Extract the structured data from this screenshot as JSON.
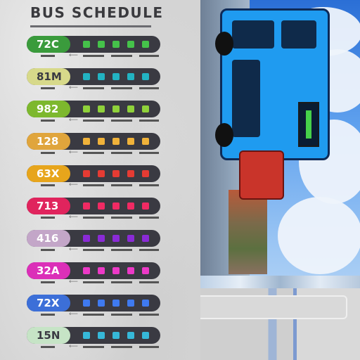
{
  "header": {
    "title": "BUS SCHEDULE"
  },
  "routes": [
    {
      "label": "72C",
      "color": "#3a9b3c",
      "dot_color": "#45c24a",
      "pale": false
    },
    {
      "label": "81M",
      "color": "#d7d98a",
      "dot_color": "#22b3c2",
      "pale": true
    },
    {
      "label": "982",
      "color": "#7db82e",
      "dot_color": "#8fd13a",
      "pale": false
    },
    {
      "label": "128",
      "color": "#e0a53c",
      "dot_color": "#f0b23a",
      "pale": false
    },
    {
      "label": "63X",
      "color": "#e7a51c",
      "dot_color": "#e53b33",
      "pale": false
    },
    {
      "label": "713",
      "color": "#e0245d",
      "dot_color": "#f02a63",
      "pale": false
    },
    {
      "label": "416",
      "color": "#c3a6c8",
      "dot_color": "#8a2ad6",
      "pale": false
    },
    {
      "label": "32A",
      "color": "#db2fb8",
      "dot_color": "#ec39c7",
      "pale": false
    },
    {
      "label": "72X",
      "color": "#3c6fd8",
      "dot_color": "#3f7af0",
      "pale": false
    },
    {
      "label": "15N",
      "color": "#c6e4c6",
      "dot_color": "#36b8d8",
      "pale": true
    }
  ],
  "photo": {
    "description_icon": "bus-photo"
  }
}
